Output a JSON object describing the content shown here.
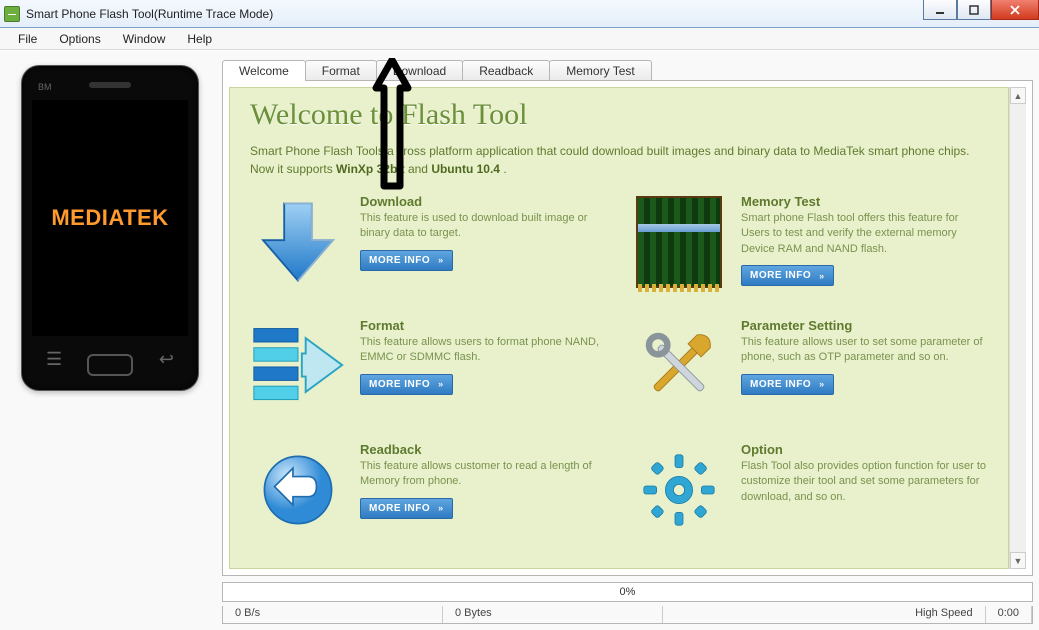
{
  "window": {
    "title": "Smart Phone Flash Tool(Runtime Trace Mode)"
  },
  "menu": {
    "file": "File",
    "options": "Options",
    "window": "Window",
    "help": "Help"
  },
  "tabs": [
    {
      "label": "Welcome",
      "active": true
    },
    {
      "label": "Format"
    },
    {
      "label": "Download"
    },
    {
      "label": "Readback"
    },
    {
      "label": "Memory Test"
    }
  ],
  "phone": {
    "brand": "MEDIATEK",
    "corner": "BM"
  },
  "welcome": {
    "hero": "Welcome to Flash Tool",
    "intro_pre": "Smart Phone Flash Tools a cross platform application that could download built images and binary data to MediaTek smart phone chips. Now it supports ",
    "intro_bold1": "WinXp 32bit",
    "intro_mid": " and ",
    "intro_bold2": "Ubuntu 10.4",
    "intro_post": ".",
    "more_info": "MORE INFO",
    "features": {
      "download": {
        "title": "Download",
        "desc": "This feature is used to download built image or binary data to target."
      },
      "memory_test": {
        "title": "Memory Test",
        "desc": "Smart phone Flash tool offers this feature for Users to test and verify the external memory Device RAM and NAND flash."
      },
      "format": {
        "title": "Format",
        "desc": "This feature allows users to format phone NAND, EMMC or SDMMC flash."
      },
      "parameter": {
        "title": "Parameter Setting",
        "desc": "This feature allows user to set some parameter of phone, such as OTP parameter and so on."
      },
      "readback": {
        "title": "Readback",
        "desc": "This feature allows customer to read a length of Memory from phone."
      },
      "option": {
        "title": "Option",
        "desc": "Flash Tool also provides option function for user to customize their tool and set some parameters for download, and so on."
      }
    }
  },
  "progress": {
    "percent": "0%"
  },
  "status": {
    "rate": "0 B/s",
    "bytes": "0 Bytes",
    "mode": "High Speed",
    "time": "0:00"
  }
}
